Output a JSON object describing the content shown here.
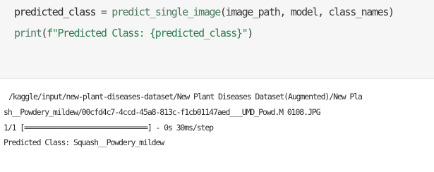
{
  "code_cell": {
    "line1": {
      "var": "predicted_class",
      "op": " = ",
      "func": "predict_single_image",
      "args": "(image_path, model, class_names)"
    },
    "line2": {
      "func": "print",
      "open": "(",
      "fstring": "f\"Predicted Class: {predicted_class}\"",
      "close": ")"
    }
  },
  "output": {
    "lines": [
      "/kaggle/input/new-plant-diseases-dataset/New Plant Diseases Dataset(Augmented)/New Pla",
      "sh__Powdery_mildew/00cfd4c7-4ccd-45a8-813c-f1cb01147aed___UMD_Powd.M 0108.JPG",
      "1/1 [==============================] - 0s 30ms/step",
      "Predicted Class: Squash__Powdery_mildew"
    ]
  }
}
